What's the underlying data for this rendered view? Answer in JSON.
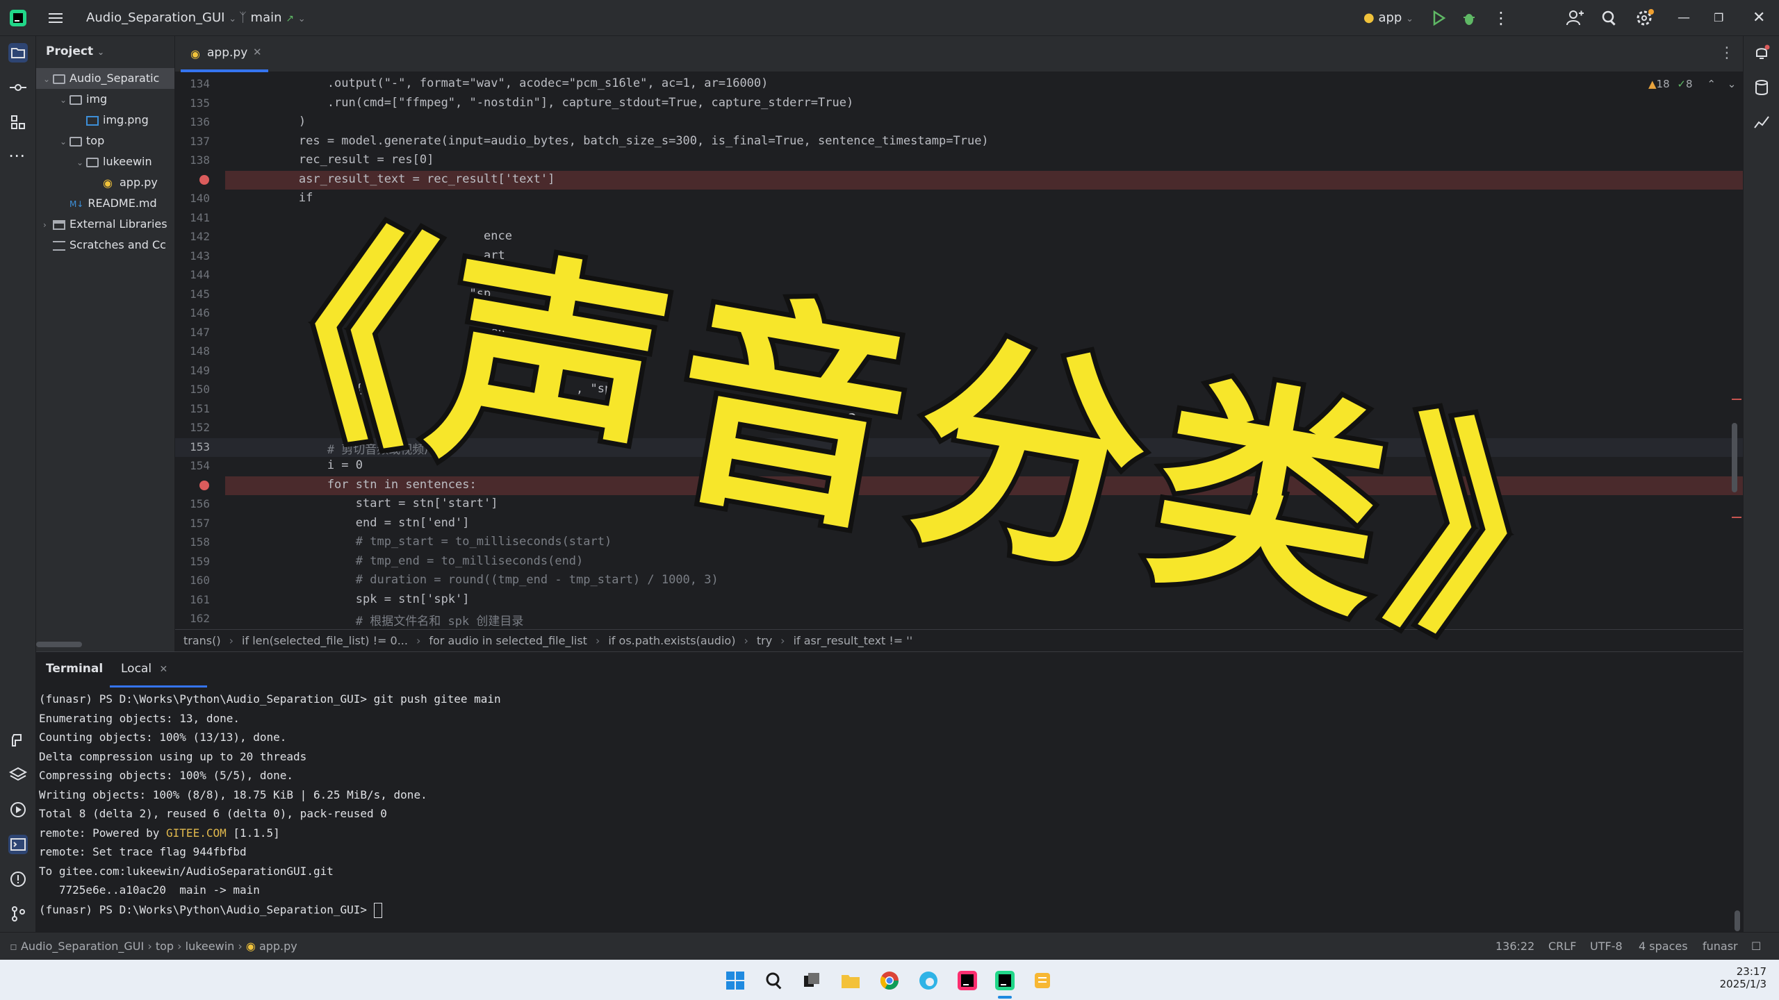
{
  "titlebar": {
    "project": "Audio_Separation_GUI",
    "branch": "main",
    "run_config": "app"
  },
  "project_panel": {
    "title": "Project",
    "tree": [
      {
        "label": "Audio_Separatic",
        "depth": 0,
        "type": "folder",
        "expanded": true
      },
      {
        "label": "img",
        "depth": 1,
        "type": "folder",
        "expanded": true
      },
      {
        "label": "img.png",
        "depth": 2,
        "type": "image"
      },
      {
        "label": "top",
        "depth": 1,
        "type": "folder",
        "expanded": true
      },
      {
        "label": "lukeewin",
        "depth": 2,
        "type": "folder",
        "expanded": true
      },
      {
        "label": "app.py",
        "depth": 3,
        "type": "python"
      },
      {
        "label": "README.md",
        "depth": 1,
        "type": "markdown"
      },
      {
        "label": "External Libraries",
        "depth": 0,
        "type": "library"
      },
      {
        "label": "Scratches and Cc",
        "depth": 0,
        "type": "scratch"
      }
    ]
  },
  "editor": {
    "tab_label": "app.py",
    "inspections": {
      "warnings": "18",
      "ok": "8"
    },
    "lines": [
      {
        "n": "134",
        "text": "            .output(\"-\", format=\"wav\", acodec=\"pcm_s16le\", ac=1, ar=16000)"
      },
      {
        "n": "135",
        "text": "            .run(cmd=[\"ffmpeg\", \"-nostdin\"], capture_stdout=True, capture_stderr=True)"
      },
      {
        "n": "136",
        "text": "        )"
      },
      {
        "n": "137",
        "text": "        res = model.generate(input=audio_bytes, batch_size_s=300, is_final=True, sentence_timestamp=True)"
      },
      {
        "n": "138",
        "text": "        rec_result = res[0]"
      },
      {
        "n": "139",
        "text": "        asr_result_text = rec_result['text']",
        "breakpoint": true
      },
      {
        "n": "140",
        "text": "        if"
      },
      {
        "n": "141",
        "text": ""
      },
      {
        "n": "142",
        "text": "                                  ence"
      },
      {
        "n": "143",
        "text": "                                  art"
      },
      {
        "n": "144",
        "text": "                                  d\"])"
      },
      {
        "n": "145",
        "text": "                                \"sp"
      },
      {
        "n": "146",
        "text": "                                 +="
      },
      {
        "n": "147",
        "text": "                                 = en"
      },
      {
        "n": "148",
        "text": ""
      },
      {
        "n": "149",
        "text": ""
      },
      {
        "n": "150",
        "text": "                {\"tex           ce[\"t          , \"sp"
      },
      {
        "n": "151",
        "text": "                )"
      },
      {
        "n": "152",
        "text": ""
      },
      {
        "n": "153",
        "text": "            # 剪切音频或视频片段",
        "current": true
      },
      {
        "n": "154",
        "text": "            i = 0"
      },
      {
        "n": "155",
        "text": "            for stn in sentences:",
        "breakpoint": true
      },
      {
        "n": "156",
        "text": "                start = stn['start']"
      },
      {
        "n": "157",
        "text": "                end = stn['end']"
      },
      {
        "n": "158",
        "text": "                # tmp_start = to_milliseconds(start)"
      },
      {
        "n": "159",
        "text": "                # tmp_end = to_milliseconds(end)"
      },
      {
        "n": "160",
        "text": "                # duration = round((tmp_end - tmp_start) / 1000, 3)"
      },
      {
        "n": "161",
        "text": "                spk = stn['spk']"
      },
      {
        "n": "162",
        "text": "                # 根据文件名和 spk 创建目录"
      }
    ]
  },
  "breadcrumbs": [
    "trans()",
    "if len(selected_file_list) != 0...",
    "for audio in selected_file_list",
    "if os.path.exists(audio)",
    "try",
    "if asr_result_text != ''"
  ],
  "terminal": {
    "tab_title": "Terminal",
    "session": "Local",
    "lines": [
      "(funasr) PS D:\\Works\\Python\\Audio_Separation_GUI> git push gitee main",
      "Enumerating objects: 13, done.",
      "Counting objects: 100% (13/13), done.",
      "Delta compression using up to 20 threads",
      "Compressing objects: 100% (5/5), done.",
      "Writing objects: 100% (8/8), 18.75 KiB | 6.25 MiB/s, done.",
      "Total 8 (delta 2), reused 6 (delta 0), pack-reused 0",
      "remote: Powered by GITEE.COM [1.1.5]",
      "remote: Set trace flag 944fbfbd",
      "To gitee.com:lukeewin/AudioSeparationGUI.git",
      "   7725e6e..a10ac20  main -> main",
      "(funasr) PS D:\\Works\\Python\\Audio_Separation_GUI> "
    ]
  },
  "statusbar": {
    "path": [
      "Audio_Separation_GUI",
      "top",
      "lukeewin",
      "app.py"
    ],
    "position": "136:22",
    "line_sep": "CRLF",
    "encoding": "UTF-8",
    "indent": "4 spaces",
    "interpreter": "funasr"
  },
  "taskbar": {
    "time": "23:17",
    "date": "2025/1/3"
  },
  "overlay": {
    "title": "《声音分类》"
  },
  "colors": {
    "accent": "#3574f0",
    "overlay_fill": "#f7e62a",
    "breakpoint": "#db5c5c"
  }
}
